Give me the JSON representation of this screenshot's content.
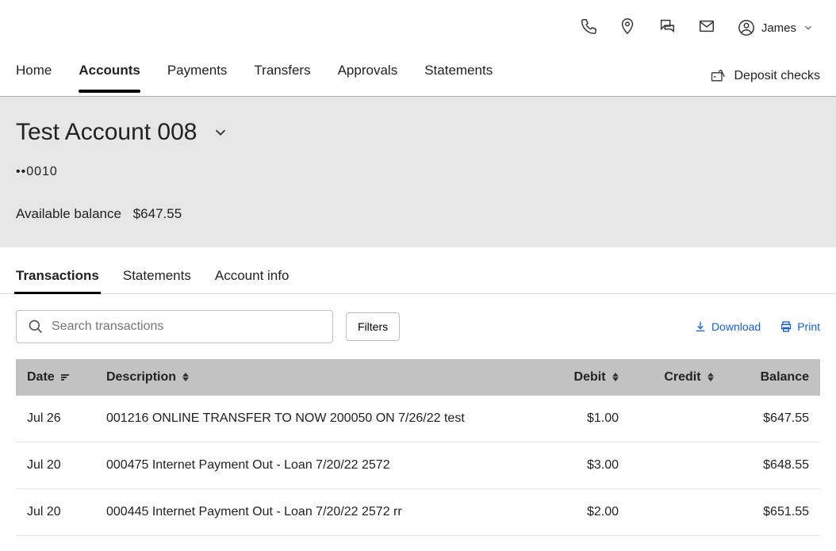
{
  "topbar": {
    "user_name": "James"
  },
  "nav": {
    "items": [
      {
        "label": "Home",
        "active": false
      },
      {
        "label": "Accounts",
        "active": true
      },
      {
        "label": "Payments",
        "active": false
      },
      {
        "label": "Transfers",
        "active": false
      },
      {
        "label": "Approvals",
        "active": false
      },
      {
        "label": "Statements",
        "active": false
      }
    ],
    "deposit_label": "Deposit checks"
  },
  "account": {
    "name": "Test Account 008",
    "masked": "••0010",
    "available_label": "Available balance",
    "available_value": "$647.55"
  },
  "subtabs": [
    {
      "label": "Transactions",
      "active": true
    },
    {
      "label": "Statements",
      "active": false
    },
    {
      "label": "Account info",
      "active": false
    }
  ],
  "search": {
    "placeholder": "Search transactions"
  },
  "filters_label": "Filters",
  "actions": {
    "download": "Download",
    "print": "Print"
  },
  "table": {
    "columns": {
      "date": "Date",
      "description": "Description",
      "debit": "Debit",
      "credit": "Credit",
      "balance": "Balance"
    },
    "rows": [
      {
        "date": "Jul 26",
        "description": "001216 ONLINE TRANSFER TO NOW 200050 ON 7/26/22 test",
        "debit": "$1.00",
        "credit": "",
        "balance": "$647.55"
      },
      {
        "date": "Jul 20",
        "description": "000475 Internet Payment Out - Loan 7/20/22 2572",
        "debit": "$3.00",
        "credit": "",
        "balance": "$648.55"
      },
      {
        "date": "Jul 20",
        "description": "000445 Internet Payment Out - Loan 7/20/22 2572 rr",
        "debit": "$2.00",
        "credit": "",
        "balance": "$651.55"
      }
    ]
  }
}
